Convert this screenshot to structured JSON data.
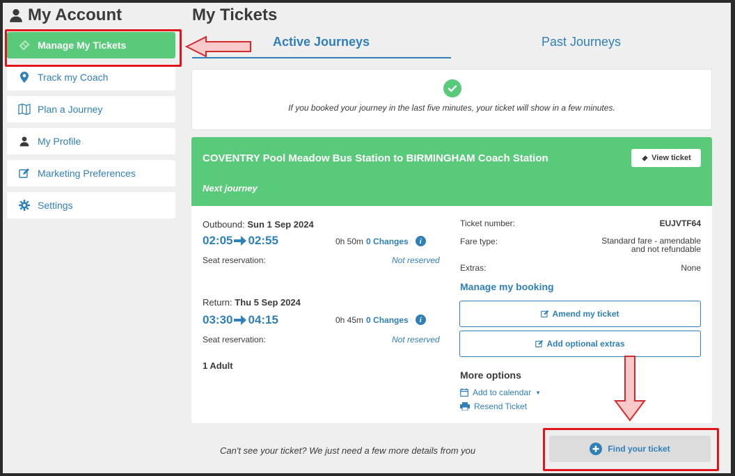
{
  "sidebar": {
    "title": "My Account",
    "items": [
      {
        "label": "Manage My Tickets",
        "icon": "ticket-icon",
        "active": true
      },
      {
        "label": "Track my Coach",
        "icon": "map-pin-icon"
      },
      {
        "label": "Plan a Journey",
        "icon": "map-icon"
      },
      {
        "label": "My Profile",
        "icon": "user-icon"
      },
      {
        "label": "Marketing Preferences",
        "icon": "edit-icon"
      },
      {
        "label": "Settings",
        "icon": "gear-icon"
      }
    ]
  },
  "main": {
    "title": "My Tickets",
    "tabs": [
      {
        "label": "Active Journeys",
        "active": true
      },
      {
        "label": "Past Journeys",
        "active": false
      }
    ],
    "info_text": "If you booked your journey in the last five minutes, your ticket will show in a few minutes.",
    "journey": {
      "route": "COVENTRY Pool Meadow Bus Station to BIRMINGHAM Coach Station",
      "next_label": "Next journey",
      "view_ticket": "View ticket",
      "outbound_label": "Outbound:",
      "outbound_date": "Sun 1 Sep 2024",
      "outbound_depart": "02:05",
      "outbound_arrive": "02:55",
      "outbound_duration": "0h 50m",
      "outbound_changes": "0 Changes",
      "seat_label": "Seat reservation:",
      "seat_value": "Not reserved",
      "return_label": "Return:",
      "return_date": "Thu 5 Sep 2024",
      "return_depart": "03:30",
      "return_arrive": "04:15",
      "return_duration": "0h 45m",
      "return_changes": "0 Changes",
      "passengers": "1 Adult",
      "ticket_number_label": "Ticket number:",
      "ticket_number": "EUJVTF64",
      "fare_type_label": "Fare type:",
      "fare_type_line1": "Standard fare - amendable",
      "fare_type_line2": "and not refundable",
      "extras_label": "Extras:",
      "extras_value": "None",
      "manage_label": "Manage my booking",
      "amend_button": "Amend my ticket",
      "extras_button": "Add optional extras",
      "more_options": "More options",
      "add_calendar": "Add to calendar",
      "resend": "Resend Ticket"
    },
    "cant_see": "Can't see your ticket? We just need a few more details from you",
    "find_button": "Find your ticket"
  },
  "colors": {
    "accent": "#2f7fb8",
    "green": "#59c97a",
    "highlight_red": "#e0151b"
  }
}
